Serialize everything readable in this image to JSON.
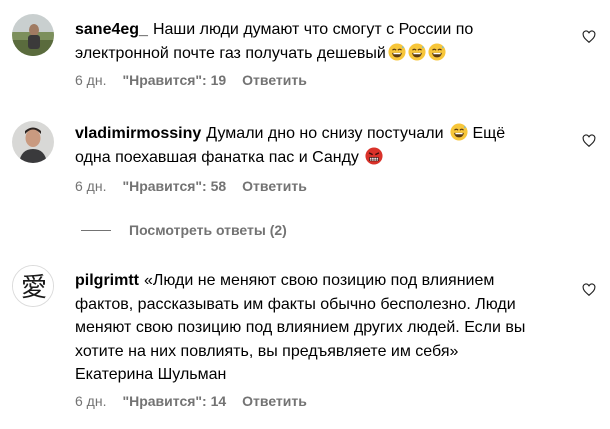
{
  "comments": [
    {
      "username": "sane4eg_",
      "text": "Наши люди думают что смогут с России по электронной почте газ получать дешевый",
      "emojis": [
        "grinning-sweat-emoji",
        "grinning-sweat-emoji",
        "grinning-sweat-emoji"
      ],
      "time": "6 дн.",
      "likes": "\"Нравится\": 19",
      "reply": "Ответить"
    },
    {
      "username": "vladimirmossiny",
      "text_before": "Думали дно но снизу постучали",
      "text_after": "Ещё одна поехавшая фанатка пас и Санду",
      "time": "6 дн.",
      "likes": "\"Нравится\": 58",
      "reply": "Ответить"
    },
    {
      "username": "pilgrimtt",
      "text": "«Люди не меняют свою позицию под влиянием фактов, рассказывать им факты обычно бесполезно. Люди меняют свою позицию под влиянием других людей. Если вы хотите на них повлиять, вы предъявляете им себя» Екатерина Шульман",
      "time": "6 дн.",
      "likes": "\"Нравится\": 14",
      "reply": "Ответить"
    }
  ],
  "view_replies": "Посмотреть ответы (2)",
  "colors": {
    "meta": "#737373",
    "emoji_face": "#f7c63a",
    "angry_face": "#d9322a"
  }
}
